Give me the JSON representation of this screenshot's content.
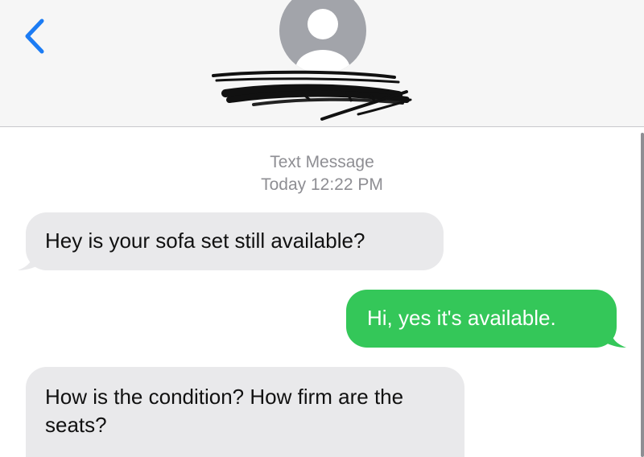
{
  "header": {
    "back_icon": "chevron-left-icon",
    "avatar_icon": "person-avatar-icon",
    "contact_name_redacted": true,
    "accent_color": "#1c7cf4"
  },
  "thread": {
    "service_label": "Text Message",
    "timestamp": "Today 12:22 PM"
  },
  "messages": [
    {
      "direction": "incoming",
      "text": "Hey is your sofa set still available?"
    },
    {
      "direction": "outgoing",
      "text": "Hi, yes it's available."
    },
    {
      "direction": "incoming",
      "text": "How is the condition? How firm are the seats?"
    }
  ],
  "colors": {
    "incoming_bubble": "#e9e9eb",
    "outgoing_bubble": "#34c759",
    "meta_text": "#8e8e93",
    "header_bg": "#f6f6f6"
  }
}
